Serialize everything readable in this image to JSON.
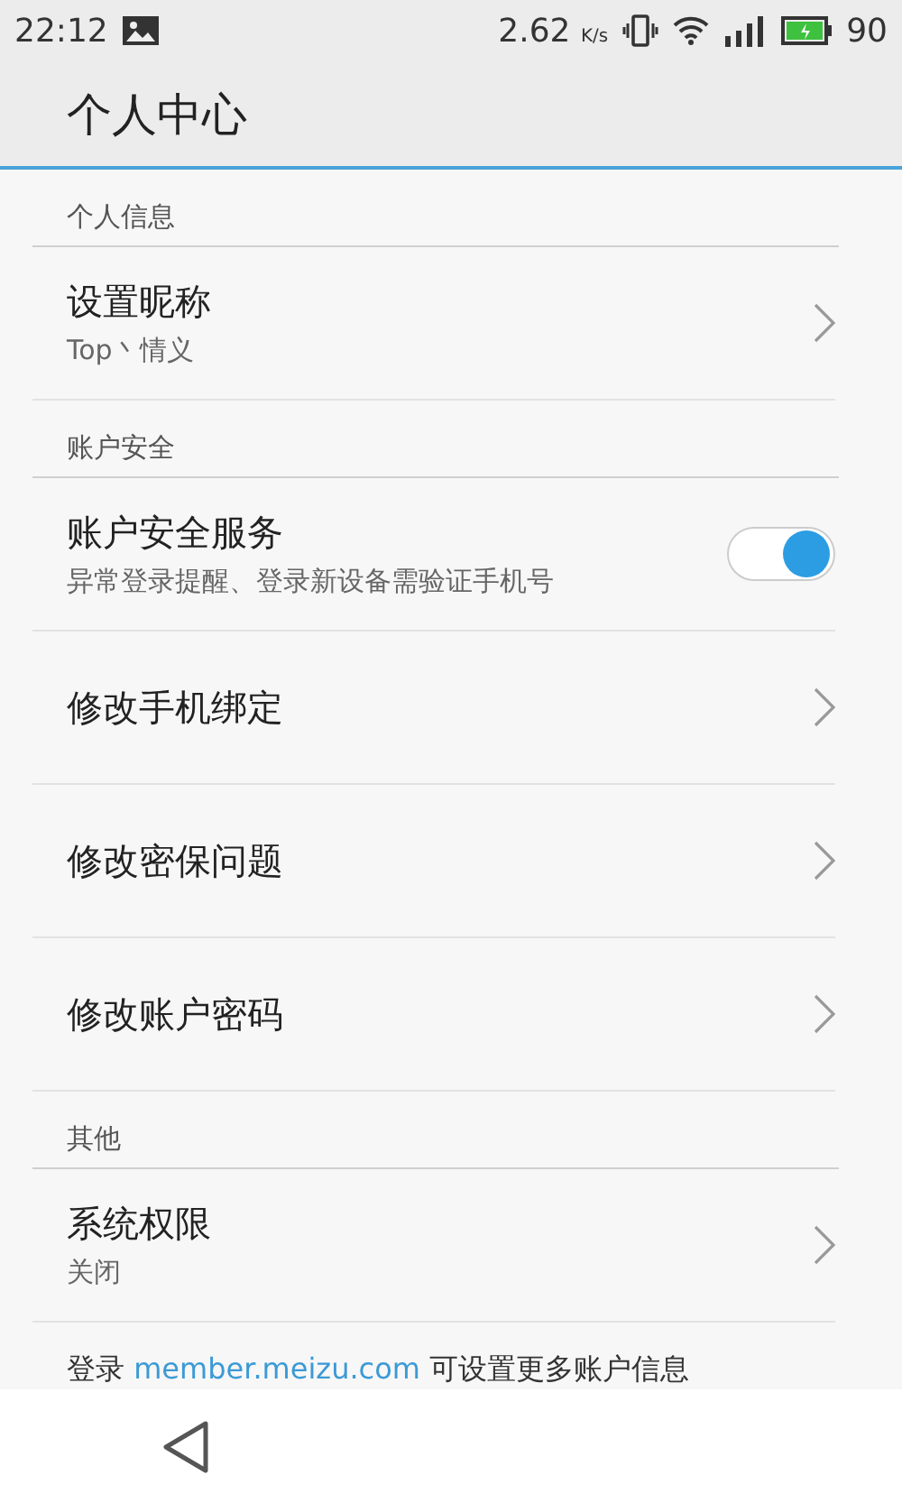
{
  "status_bar": {
    "time": "22:12",
    "speed": "2.62",
    "speed_unit": "K/s",
    "battery": "90"
  },
  "header": {
    "title": "个人中心"
  },
  "sections": [
    {
      "title": "个人信息",
      "items": [
        {
          "kind": "chevron",
          "label": "设置昵称",
          "subtitle": "Top丶情义"
        }
      ]
    },
    {
      "title": "账户安全",
      "items": [
        {
          "kind": "toggle",
          "label": "账户安全服务",
          "subtitle": "异常登录提醒、登录新设备需验证手机号",
          "on": true
        },
        {
          "kind": "chevron",
          "label": "修改手机绑定"
        },
        {
          "kind": "chevron",
          "label": "修改密保问题"
        },
        {
          "kind": "chevron",
          "label": "修改账户密码"
        }
      ]
    },
    {
      "title": "其他",
      "items": [
        {
          "kind": "chevron",
          "label": "系统权限",
          "subtitle": "关闭"
        }
      ]
    }
  ],
  "footer": {
    "before": "登录",
    "link": "member.meizu.com",
    "after": "可设置更多账户信息"
  }
}
